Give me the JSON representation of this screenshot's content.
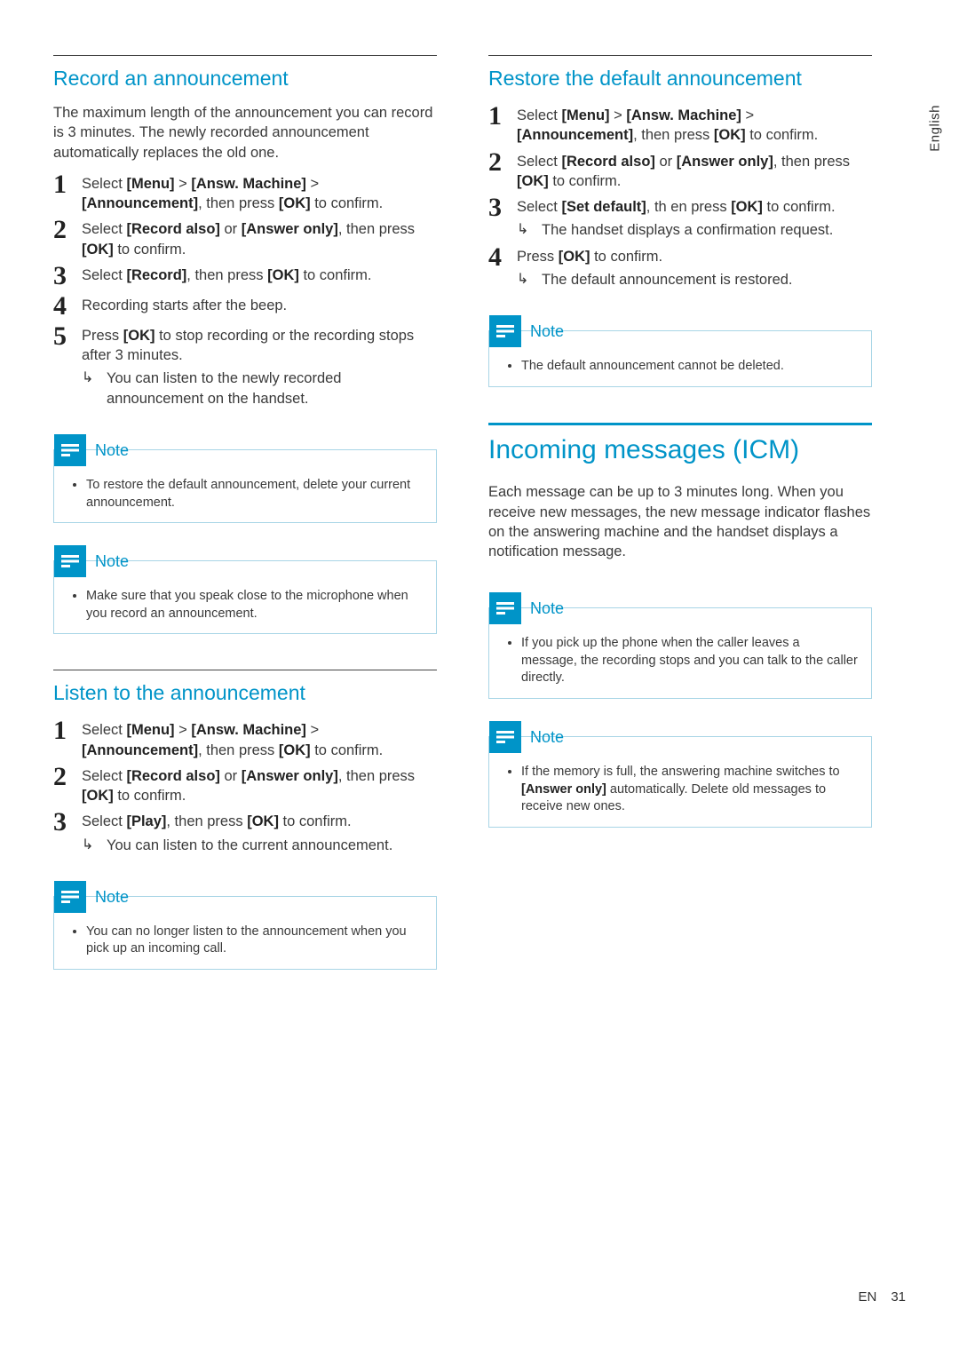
{
  "side_tab": "English",
  "footer": {
    "lang": "EN",
    "page": "31"
  },
  "left": {
    "record": {
      "heading": "Record an announcement",
      "intro": "The maximum length of the announcement you can record is 3 minutes. The newly recorded announcement automatically replaces the old one.",
      "steps": [
        {
          "n": "1",
          "pre": "Select ",
          "b1": "[Menu]",
          "m1": " > ",
          "b2": "[Answ. Machine]",
          "m2": " > ",
          "b3": "[Announcement]",
          "m3": ", then press ",
          "b4": "[OK]",
          "post": " to confirm."
        },
        {
          "n": "2",
          "pre": "Select ",
          "b1": "[Record also]",
          "m1": " or ",
          "b2": "[Answer only]",
          "m2": ", then press ",
          "b3": "[OK]",
          "post": " to confirm."
        },
        {
          "n": "3",
          "pre": "Select ",
          "b1": "[Record]",
          "m1": ", then press ",
          "b2": "[OK]",
          "post": " to confirm."
        },
        {
          "n": "4",
          "pre": "Recording starts after the beep."
        },
        {
          "n": "5",
          "pre": "Press ",
          "b1": "[OK]",
          "post": " to stop recording or the recording stops after 3 minutes.",
          "result": "You can listen to the newly recorded announcement on the handset."
        }
      ],
      "note1": "To restore the default announcement, delete your current announcement.",
      "note2": "Make sure that you speak close to the microphone when you record an announcement."
    },
    "listen": {
      "heading": "Listen to the announcement",
      "steps": [
        {
          "n": "1",
          "pre": "Select ",
          "b1": "[Menu]",
          "m1": " > ",
          "b2": "[Answ. Machine]",
          "m2": " > ",
          "b3": "[Announcement]",
          "m3": ", then press ",
          "b4": "[OK]",
          "post": " to confirm."
        },
        {
          "n": "2",
          "pre": "Select ",
          "b1": "[Record also]",
          "m1": " or ",
          "b2": "[Answer only]",
          "m2": ", then press ",
          "b3": "[OK]",
          "post": " to confirm."
        },
        {
          "n": "3",
          "pre": "Select ",
          "b1": "[Play]",
          "m1": ", then press ",
          "b2": "[OK]",
          "post": " to confirm.",
          "result": "You can listen to the current announcement."
        }
      ],
      "note": "You can no longer listen to the announcement when you pick up an incoming call."
    }
  },
  "right": {
    "restore": {
      "heading": "Restore the default announcement",
      "steps": [
        {
          "n": "1",
          "pre": "Select ",
          "b1": "[Menu]",
          "m1": " > ",
          "b2": "[Answ. Machine]",
          "m2": " > ",
          "b3": "[Announcement]",
          "m3": ", then press ",
          "b4": "[OK]",
          "post": " to confirm."
        },
        {
          "n": "2",
          "pre": "Select ",
          "b1": "[Record also]",
          "m1": " or ",
          "b2": "[Answer only]",
          "m2": ", then press ",
          "b3": "[OK]",
          "post": " to confirm."
        },
        {
          "n": "3",
          "pre": "Select ",
          "b1": "[Set default]",
          "m1": ", th en press ",
          "b2": "[OK]",
          "post": " to confirm.",
          "result": "The handset displays a confirmation request."
        },
        {
          "n": "4",
          "pre": "Press ",
          "b1": "[OK]",
          "post": " to confirm.",
          "result": "The default announcement is restored."
        }
      ],
      "note": "The default announcement cannot be deleted."
    },
    "icm": {
      "heading": "Incoming messages (ICM)",
      "intro": "Each message can be up to 3 minutes long. When you receive new messages, the new message indicator flashes on the answering machine and the handset displays a notification message.",
      "note1": "If you pick up the phone when the caller leaves a message, the recording stops and you can talk to the caller directly.",
      "note2_pre": "If the memory is full, the answering machine switches to ",
      "note2_b": "[Answer only]",
      "note2_post": " automatically. Delete old messages to receive new ones."
    }
  },
  "note_label": "Note"
}
